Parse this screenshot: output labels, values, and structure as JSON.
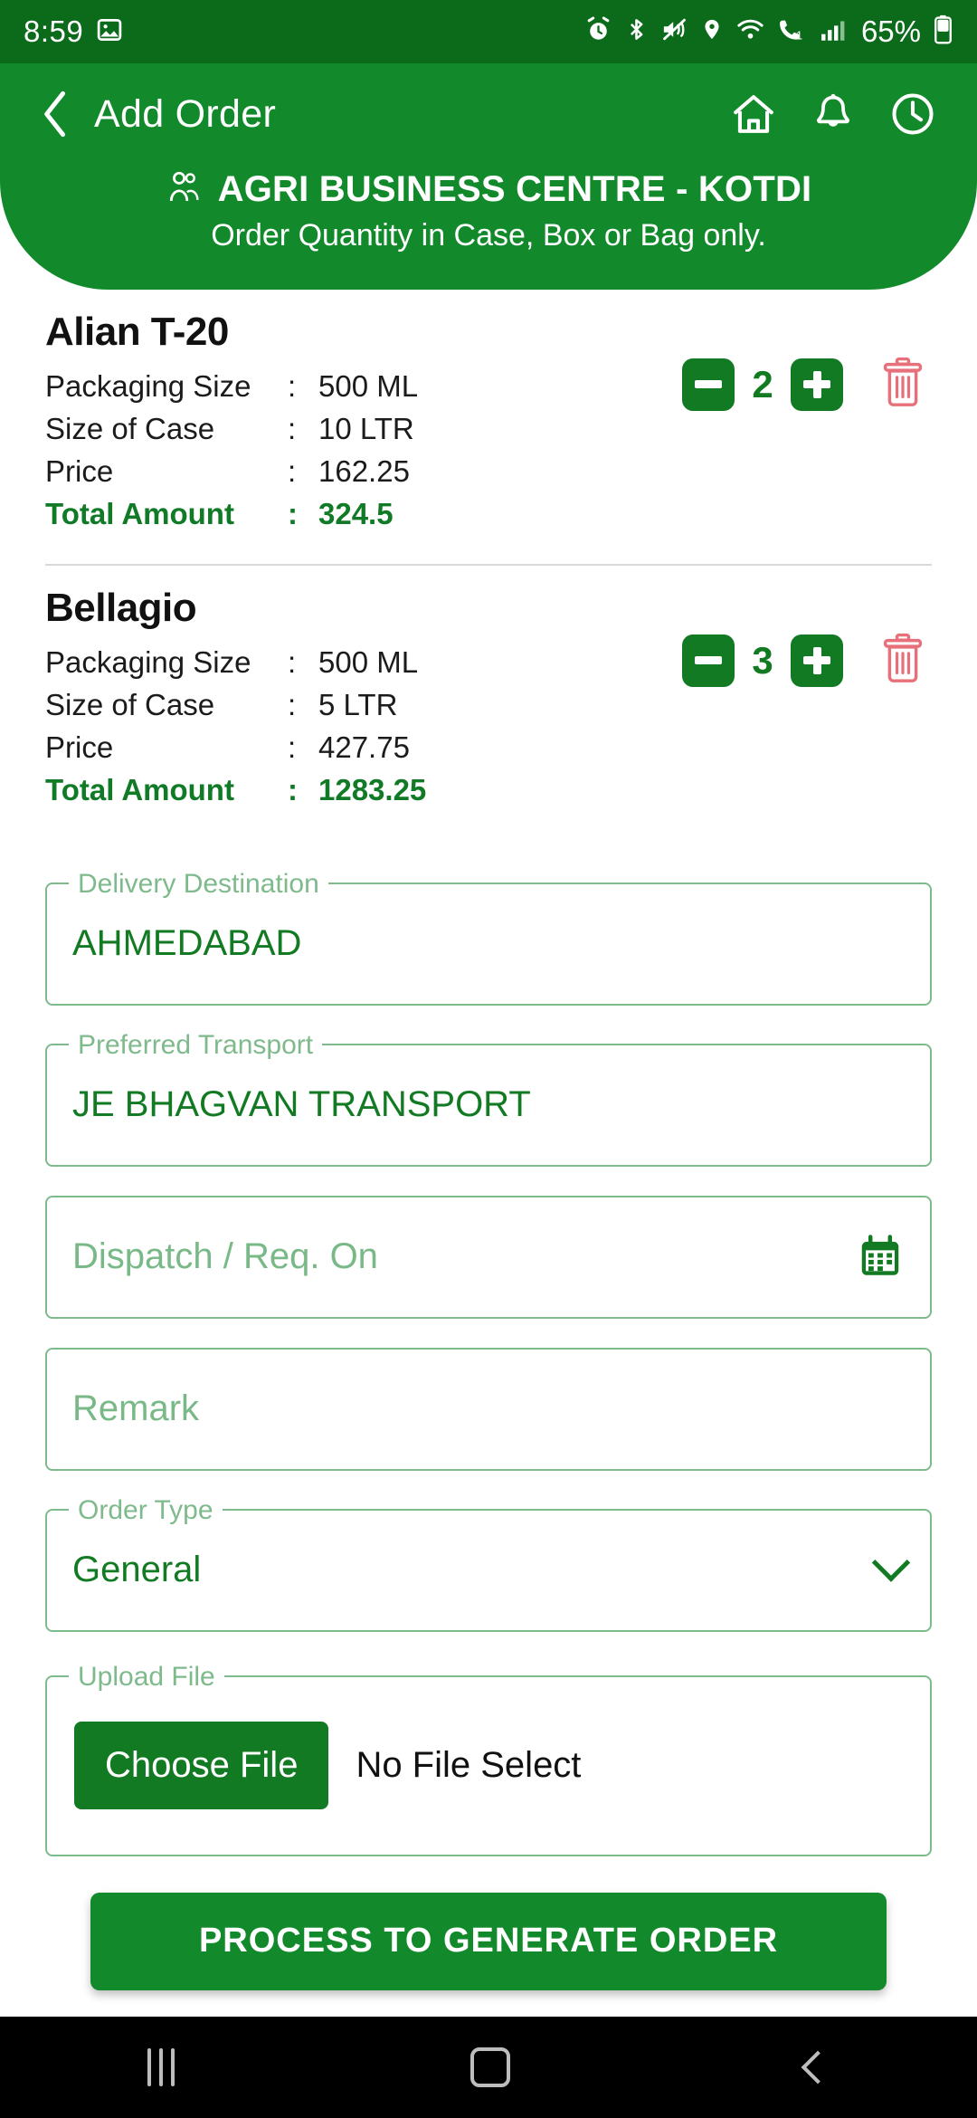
{
  "status_bar": {
    "time": "8:59",
    "battery_text": "65%",
    "left_icons": [
      "image-icon"
    ],
    "right_icons": [
      "alarm-icon",
      "bluetooth-icon",
      "mute-vibrate-icon",
      "location-icon",
      "wifi-icon",
      "missed-call-icon",
      "signal-icon"
    ]
  },
  "appbar": {
    "back_icon": "chevron-left-icon",
    "title": "Add Order",
    "actions": [
      {
        "name": "home-icon"
      },
      {
        "name": "bell-icon"
      },
      {
        "name": "clock-icon"
      }
    ],
    "party_icon": "people-icon",
    "party_name": "AGRI BUSINESS CENTRE -  KOTDI",
    "subtitle": "Order Quantity in Case, Box or Bag only."
  },
  "labels": {
    "packaging_size": "Packaging Size",
    "size_of_case": "Size of Case",
    "price": "Price",
    "total_amount": "Total Amount",
    "colon": ":"
  },
  "products": [
    {
      "name": "Alian T-20",
      "packaging_size": "500 ML",
      "size_of_case": "10 LTR",
      "price": "162.25",
      "total_amount": "324.5",
      "quantity": "2",
      "minus_icon": "minus-icon",
      "plus_icon": "plus-icon",
      "delete_icon": "trash-icon"
    },
    {
      "name": "Bellagio",
      "packaging_size": "500 ML",
      "size_of_case": "5 LTR",
      "price": "427.75",
      "total_amount": "1283.25",
      "quantity": "3",
      "minus_icon": "minus-icon",
      "plus_icon": "plus-icon",
      "delete_icon": "trash-icon"
    }
  ],
  "form": {
    "delivery_destination": {
      "label": "Delivery Destination",
      "value": "AHMEDABAD"
    },
    "preferred_transport": {
      "label": "Preferred Transport",
      "value": "JE BHAGVAN TRANSPORT"
    },
    "dispatch": {
      "placeholder": "Dispatch / Req. On",
      "value": "",
      "icon": "calendar-icon"
    },
    "remark": {
      "placeholder": "Remark",
      "value": ""
    },
    "order_type": {
      "label": "Order Type",
      "value": "General",
      "icon": "chevron-down-icon"
    },
    "upload_file": {
      "label": "Upload File",
      "button_label": "Choose File",
      "status": "No File Select"
    }
  },
  "submit": {
    "label": "PROCESS TO GENERATE ORDER"
  },
  "navbar": {
    "recent_icon": "recent-apps-icon",
    "home_icon": "home-square-icon",
    "back_icon": "back-chevron-icon"
  },
  "colors": {
    "status_bar_green": "#0b6b1b",
    "header_green": "#128a2b",
    "accent_green": "#127a22",
    "field_border": "#7fba8c",
    "label_green": "#7fba8c",
    "trash_red": "#e8707a"
  }
}
